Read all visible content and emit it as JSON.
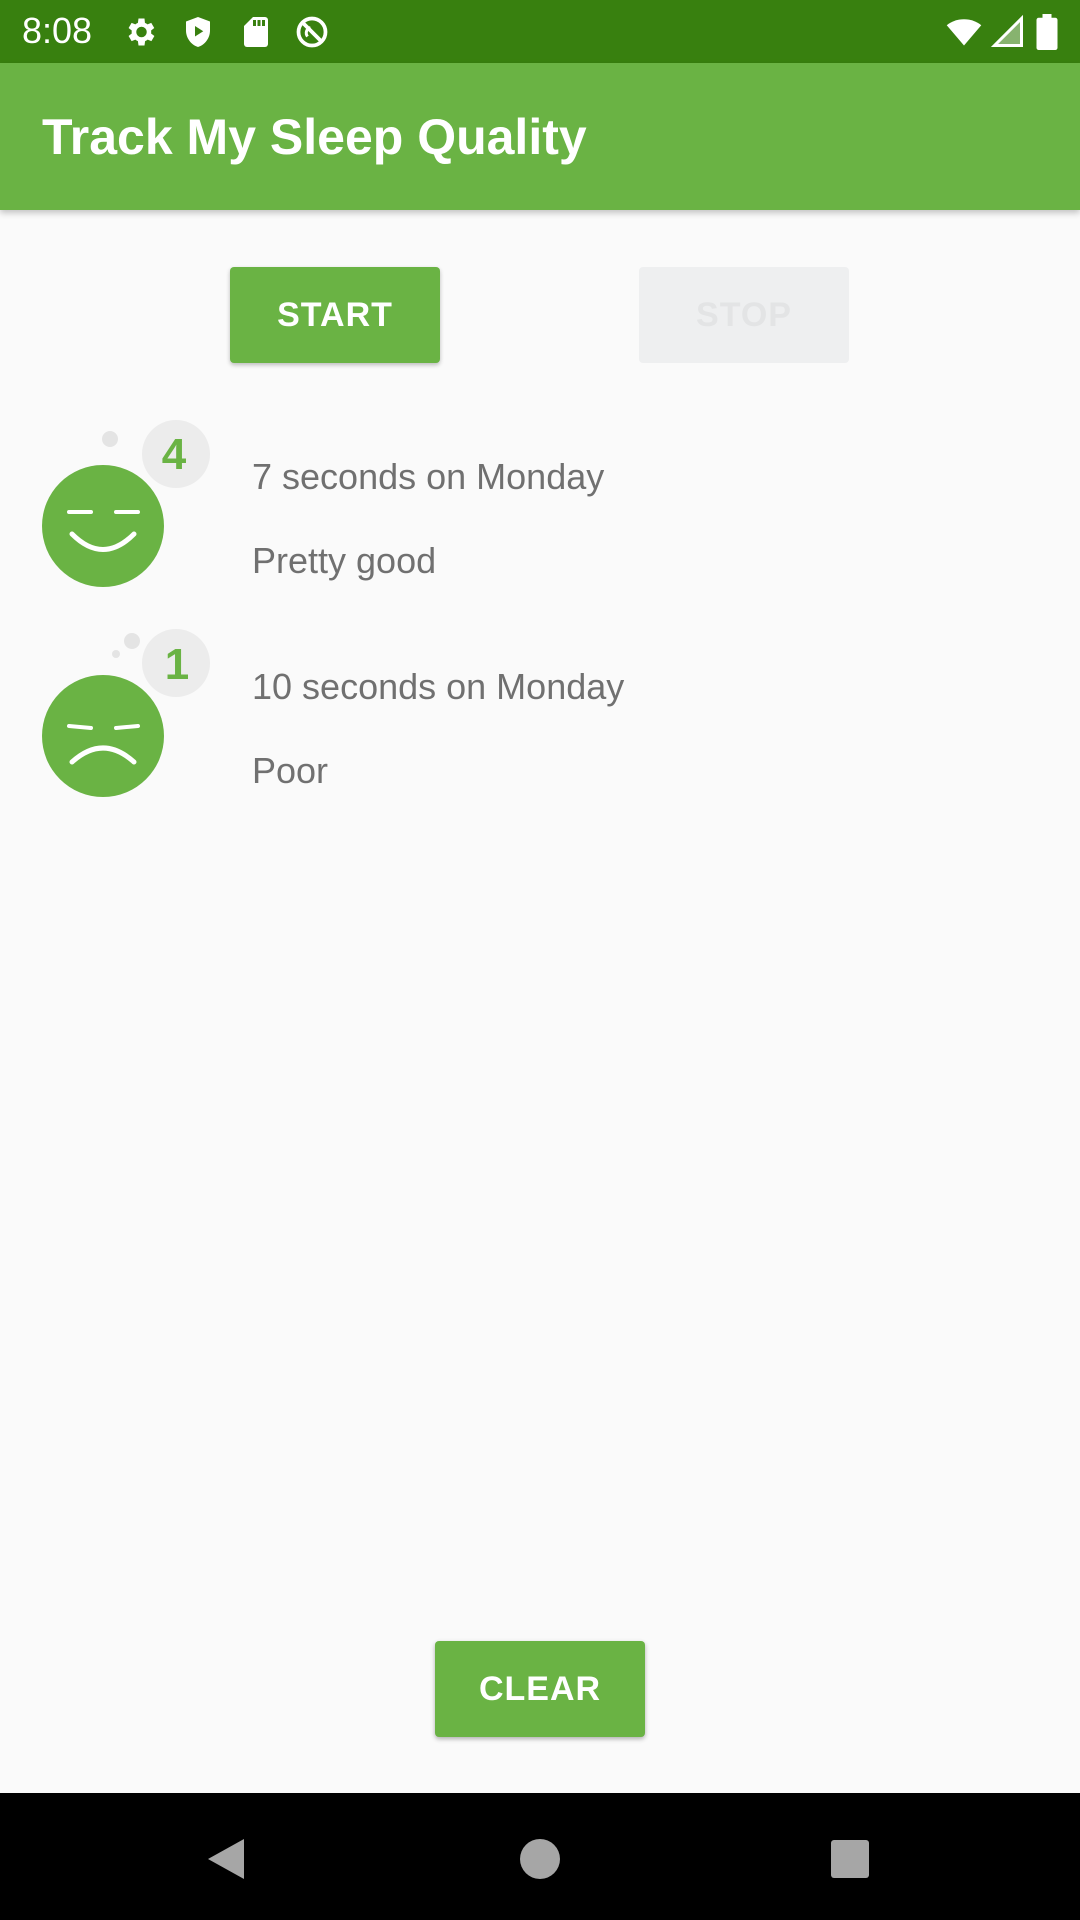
{
  "status_bar": {
    "time": "8:08",
    "left_icons": [
      "gear-icon",
      "shield-play-icon",
      "sd-card-icon",
      "no-sync-icon"
    ],
    "right_icons": [
      "wifi-icon",
      "signal-icon",
      "battery-icon"
    ]
  },
  "app_bar": {
    "title": "Track My Sleep Quality"
  },
  "buttons": {
    "start": "START",
    "stop": "STOP",
    "clear": "CLEAR"
  },
  "nights": [
    {
      "rating": "4",
      "duration": "7 seconds on Monday",
      "quality": "Pretty good",
      "mood": "happy-face-icon"
    },
    {
      "rating": "1",
      "duration": "10 seconds on Monday",
      "quality": "Poor",
      "mood": "sad-face-icon"
    }
  ],
  "colors": {
    "primary": "#6ab344",
    "primary_dark": "#38800f",
    "text_secondary": "#707070",
    "background": "#fafafa"
  }
}
